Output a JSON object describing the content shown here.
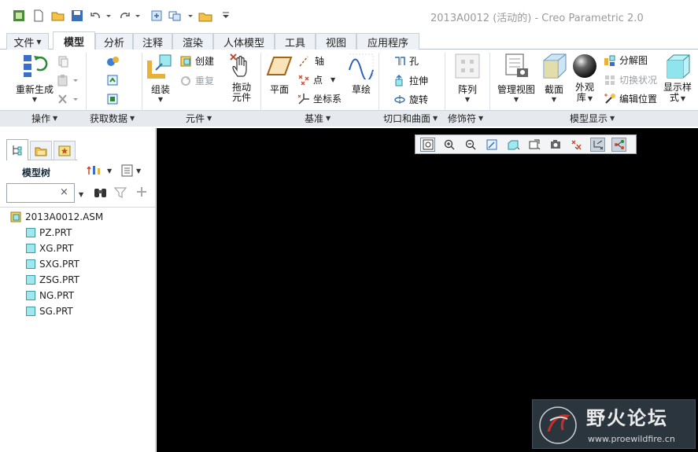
{
  "window": {
    "title": "2013A0012 (活动的) - Creo Parametric 2.0"
  },
  "quick_access": {
    "icons": [
      "app-icon",
      "new-icon",
      "open-icon",
      "save-icon",
      "undo-icon",
      "redo-icon",
      "regenerate-icon",
      "windows-icon",
      "close-window-icon",
      "customize-icon"
    ]
  },
  "tabs": [
    {
      "label": "文件",
      "active": false
    },
    {
      "label": "模型",
      "active": true
    },
    {
      "label": "分析",
      "active": false
    },
    {
      "label": "注释",
      "active": false
    },
    {
      "label": "渲染",
      "active": false
    },
    {
      "label": "人体模型",
      "active": false
    },
    {
      "label": "工具",
      "active": false
    },
    {
      "label": "视图",
      "active": false
    },
    {
      "label": "应用程序",
      "active": false
    }
  ],
  "ribbon": {
    "regenerate": "重新生成",
    "assemble": "组装",
    "create": "创建",
    "repeat": "重复",
    "drag": "拖动",
    "drag2": "元件",
    "plane": "平面",
    "axis": "轴",
    "point": "点",
    "csys": "坐标系",
    "sketch": "草绘",
    "hole": "孔",
    "extrude": "拉伸",
    "revolve": "旋转",
    "pattern": "阵列",
    "manage_views": "管理视图",
    "section": "截面",
    "appearance": "外观",
    "appearance2": "库",
    "exploded": "分解图",
    "toggle_status": "切换状况",
    "edit_position": "编辑位置",
    "display_style": "显示样",
    "display_style2": "式"
  },
  "groups": {
    "operations": "操作",
    "get_data": "获取数据",
    "component": "元件",
    "datum": "基准",
    "cut_surface": "切口和曲面",
    "modifiers": "修饰符",
    "model_display": "模型显示"
  },
  "left_panel": {
    "header": "模型树",
    "search_value": "",
    "search_clear": "×",
    "root": "2013A0012.ASM",
    "parts": [
      "PZ.PRT",
      "XG.PRT",
      "SXG.PRT",
      "ZSG.PRT",
      "NG.PRT",
      "SG.PRT"
    ]
  },
  "view_toolbar": {
    "icons": [
      "refit-icon",
      "zoom-in-icon",
      "zoom-out-icon",
      "repaint-icon",
      "display-style-icon",
      "saved-views-icon",
      "view-manager-icon",
      "datum-display-icon",
      "spin-center-icon",
      "annotation-display-icon"
    ]
  },
  "watermark": {
    "name": "野火论坛",
    "url": "www.proewildfire.cn"
  },
  "colors": {
    "viewport_bg": "#000000",
    "ribbon_bg": "#ffffff",
    "group_bar": "#e6e9ee",
    "part_icon": "#9fe8f0",
    "watermark_accent": "#e0312b"
  }
}
